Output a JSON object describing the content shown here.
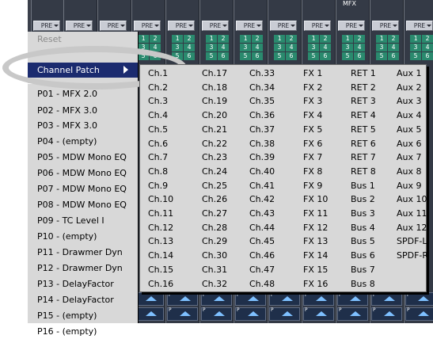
{
  "mixer": {
    "mfx_label": "MFX",
    "pre_label": "PRE",
    "channel_numbers": [
      "1",
      "2",
      "3",
      "4",
      "5",
      "6"
    ],
    "fader_letter": "P"
  },
  "preset_menu": {
    "items": [
      {
        "label": "Reset",
        "state": "disabled"
      },
      {
        "label": "",
        "state": "normal"
      },
      {
        "label": "Channel Patch",
        "state": "selected"
      },
      {
        "label": "P01 - MFX 2.0",
        "state": "normal"
      },
      {
        "label": "P02 - MFX 3.0",
        "state": "normal"
      },
      {
        "label": "P03 - MFX 3.0",
        "state": "normal"
      },
      {
        "label": "P04 - (empty)",
        "state": "normal"
      },
      {
        "label": "P05 - MDW Mono EQ",
        "state": "normal"
      },
      {
        "label": "P06 - MDW Mono EQ",
        "state": "normal"
      },
      {
        "label": "P07 - MDW Mono EQ",
        "state": "normal"
      },
      {
        "label": "P08 - MDW Mono EQ",
        "state": "normal"
      },
      {
        "label": "P09 - TC Level I",
        "state": "normal"
      },
      {
        "label": "P10 - (empty)",
        "state": "normal"
      },
      {
        "label": "P11 - Drawmer Dyn",
        "state": "normal"
      },
      {
        "label": "P12 - Drawmer Dyn",
        "state": "normal"
      },
      {
        "label": "P13 - DelayFactor",
        "state": "normal"
      },
      {
        "label": "P14 - DelayFactor",
        "state": "normal"
      },
      {
        "label": "P15 - (empty)",
        "state": "normal"
      },
      {
        "label": "P16 - (empty)",
        "state": "normal"
      }
    ]
  },
  "channel_patch": {
    "columns": [
      [
        "Ch.1",
        "Ch.2",
        "Ch.3",
        "Ch.4",
        "Ch.5",
        "Ch.6",
        "Ch.7",
        "Ch.8",
        "Ch.9",
        "Ch.10",
        "Ch.11",
        "Ch.12",
        "Ch.13",
        "Ch.14",
        "Ch.15",
        "Ch.16"
      ],
      [
        "Ch.17",
        "Ch.18",
        "Ch.19",
        "Ch.20",
        "Ch.21",
        "Ch.22",
        "Ch.23",
        "Ch.24",
        "Ch.25",
        "Ch.26",
        "Ch.27",
        "Ch.28",
        "Ch.29",
        "Ch.30",
        "Ch.31",
        "Ch.32"
      ],
      [
        "Ch.33",
        "Ch.34",
        "Ch.35",
        "Ch.36",
        "Ch.37",
        "Ch.38",
        "Ch.39",
        "Ch.40",
        "Ch.41",
        "Ch.42",
        "Ch.43",
        "Ch.44",
        "Ch.45",
        "Ch.46",
        "Ch.47",
        "Ch.48"
      ],
      [
        "FX 1",
        "FX 2",
        "FX 3",
        "FX 4",
        "FX 5",
        "FX 6",
        "FX 7",
        "FX 8",
        "FX 9",
        "FX 10",
        "FX 11",
        "FX 12",
        "FX 13",
        "FX 14",
        "FX 15",
        "FX 16"
      ],
      [
        "RET 1",
        "RET 2",
        "RET 3",
        "RET 4",
        "RET 5",
        "RET 6",
        "RET 7",
        "RET 8",
        "Bus 1",
        "Bus 2",
        "Bus 3",
        "Bus 4",
        "Bus 5",
        "Bus 6",
        "Bus 7",
        "Bus 8"
      ],
      [
        "Aux 1",
        "Aux 2",
        "Aux 3",
        "Aux 4",
        "Aux 5",
        "Aux 6",
        "Aux 7",
        "Aux 8",
        "Aux 9",
        "Aux 10",
        "Aux 11",
        "Aux 12",
        "SPDF-L",
        "SPDF-R",
        "",
        ""
      ]
    ]
  },
  "colors": {
    "menu_selected_bg": "#1b2b6f",
    "menu_bg": "#d8d8d8",
    "channel_number_bg": "#2a8a6e",
    "fader_arrow": "#7ec0ff"
  },
  "icons": {
    "submenu_arrow": "triangle-right-icon",
    "pre_dropdown": "chevron-down-icon",
    "fader_up": "arrow-up-icon"
  }
}
